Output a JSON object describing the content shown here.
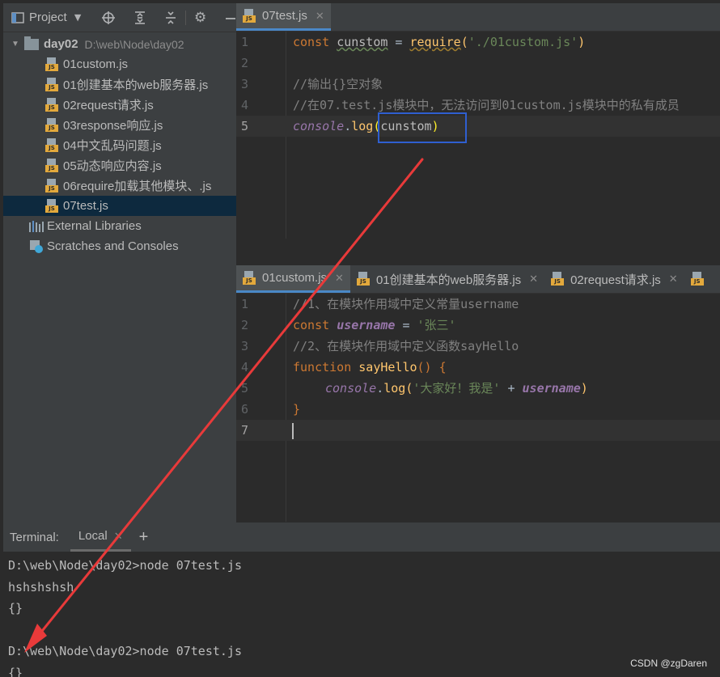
{
  "project_panel": {
    "title": "Project",
    "root": {
      "name": "day02",
      "path": "D:\\web\\Node\\day02"
    },
    "files": [
      {
        "name": "01custom.js"
      },
      {
        "name": "01创建基本的web服务器.js"
      },
      {
        "name": "02request请求.js"
      },
      {
        "name": "03response响应.js"
      },
      {
        "name": "04中文乱码问题.js"
      },
      {
        "name": "05动态响应内容.js"
      },
      {
        "name": "06require加载其他模块、.js"
      },
      {
        "name": "07test.js",
        "selected": true
      }
    ],
    "external_libraries": "External Libraries",
    "scratches": "Scratches and Consoles"
  },
  "editor_top": {
    "tab": "07test.js",
    "line_numbers": [
      "1",
      "2",
      "3",
      "4",
      "5"
    ],
    "lines": {
      "l1": {
        "kw": "const",
        "name": "cunstom",
        "eq": " = ",
        "fn": "require",
        "open": "(",
        "str": "'./01custom.js'",
        "close": ")"
      },
      "l3": "//输出{}空对象",
      "l4": "//在07.test.js模块中，无法访问到01custom.js模块中的私有成员",
      "l5": {
        "obj": "console",
        "dot": ".",
        "fn": "log",
        "open": "(",
        "arg": "cunstom",
        "close": ")"
      }
    }
  },
  "editor_bottom": {
    "tabs": [
      "01custom.js",
      "01创建基本的web服务器.js",
      "02request请求.js"
    ],
    "line_numbers": [
      "1",
      "2",
      "3",
      "4",
      "5",
      "6",
      "7"
    ],
    "lines": {
      "l1": "//1、在模块作用域中定义常量username",
      "l2": {
        "kw": "const",
        "name": "username",
        "eq": " = ",
        "str": "'张三'"
      },
      "l3": "//2、在模块作用域中定义函数sayHello",
      "l4": {
        "kw": "function",
        "name": "sayHello",
        "rest": "() {"
      },
      "l5": {
        "obj": "console",
        "dot": ".",
        "fn": "log",
        "open": "(",
        "str": "'大家好！我是'",
        "plus": " + ",
        "var": "username",
        "close": ")"
      },
      "l6": "}"
    }
  },
  "terminal": {
    "title": "Terminal:",
    "tab": "Local",
    "lines": [
      "D:\\web\\Node\\day02>node 07test.js",
      "hshshshsh",
      "{}",
      "",
      "D:\\web\\Node\\day02>node 07test.js",
      "{}"
    ]
  },
  "watermark": "CSDN @zgDaren",
  "colors": {
    "background": "#2b2b2b",
    "panel": "#3c3f41",
    "selection": "#0d293e",
    "annotation_box": "#2f5fd0",
    "annotation_arrow": "#e83a3a"
  }
}
